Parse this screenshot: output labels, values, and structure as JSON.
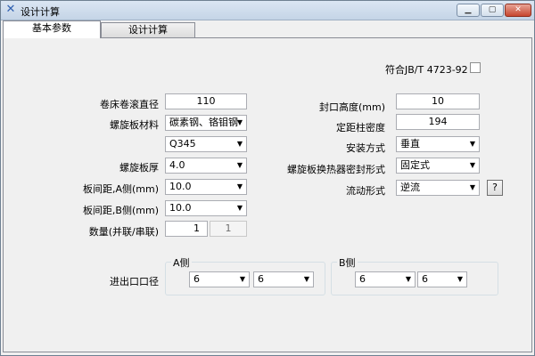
{
  "window": {
    "title": "设计计算",
    "app_icon": "x-app-icon",
    "min_glyph": "▁",
    "max_glyph": "▢",
    "close_glyph": "✕"
  },
  "tabs": [
    {
      "label": "基本参数",
      "active": true
    },
    {
      "label": "设计计算",
      "active": false
    }
  ],
  "standard": {
    "label": "符合JB/T 4723-92",
    "checked": false
  },
  "left": {
    "roll_diameter": {
      "label": "卷床卷滚直径",
      "value": "110"
    },
    "plate_material": {
      "label": "螺旋板材料",
      "value": "碳素钢、铬钼钢"
    },
    "material_grade": {
      "value": "Q345"
    },
    "plate_thickness": {
      "label": "螺旋板厚",
      "value": "4.0"
    },
    "spacing_a": {
      "label": "板间距,A侧(mm)",
      "value": "10.0"
    },
    "spacing_b": {
      "label": "板间距,B侧(mm)",
      "value": "10.0"
    },
    "quantity": {
      "label": "数量(并联/串联)",
      "value": "1",
      "value2": "1"
    }
  },
  "right": {
    "seal_height": {
      "label": "封口高度(mm)",
      "value": "10"
    },
    "spacer_density": {
      "label": "定距柱密度",
      "value": "194"
    },
    "install_method": {
      "label": "安装方式",
      "value": "垂直"
    },
    "seal_type": {
      "label": "螺旋板换热器密封形式",
      "value": "固定式"
    },
    "flow_type": {
      "label": "流动形式",
      "value": "逆流"
    },
    "help_label": "?"
  },
  "ports": {
    "label": "进出口口径",
    "a_side": {
      "title": "A侧",
      "in": "6",
      "out": "6"
    },
    "b_side": {
      "title": "B侧",
      "in": "6",
      "out": "6"
    }
  },
  "colors": {
    "window_bg": "#f0f0f0",
    "titlebar": "#c4d4e6",
    "close_btn": "#c6452e"
  }
}
